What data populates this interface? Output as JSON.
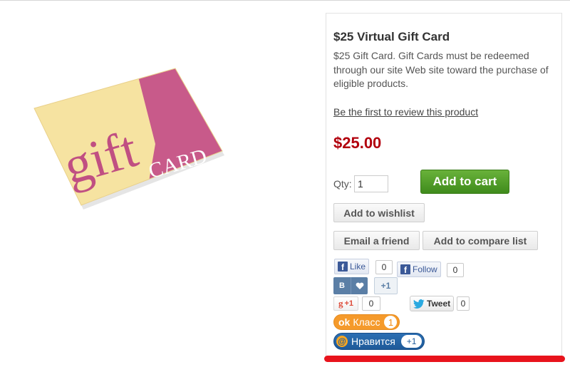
{
  "product": {
    "title": "$25 Virtual Gift Card",
    "description": "$25 Gift Card. Gift Cards must be redeemed through our site Web site toward the purchase of eligible products.",
    "review_link": "Be the first to review this product",
    "price": "$25.00"
  },
  "image": {
    "word_gift": "gift",
    "word_card": "CARD"
  },
  "cart": {
    "qty_label": "Qty:",
    "qty_value": "1",
    "add_to_cart_label": "Add to cart"
  },
  "actions": {
    "wishlist_label": "Add to wishlist",
    "email_label": "Email a friend",
    "compare_label": "Add to compare list"
  },
  "social": {
    "fb_like_label": "Like",
    "fb_like_count": "0",
    "fb_follow_label": "Follow",
    "fb_follow_count": "0",
    "vk_letter": "B",
    "vk_count": "+1",
    "gplus_label": "+1",
    "gplus_count": "0",
    "tweet_label": "Tweet",
    "tweet_count": "0",
    "ok_label": "Класс",
    "ok_count": "1",
    "mailru_label": "Нравится",
    "mailru_count": "+1"
  },
  "colors": {
    "price": "#b2000d",
    "add_to_cart": "#4f9e29",
    "bottom_bar": "#e8131c",
    "card_yellow": "#f6e3a1",
    "card_pink": "#c85a8a"
  }
}
